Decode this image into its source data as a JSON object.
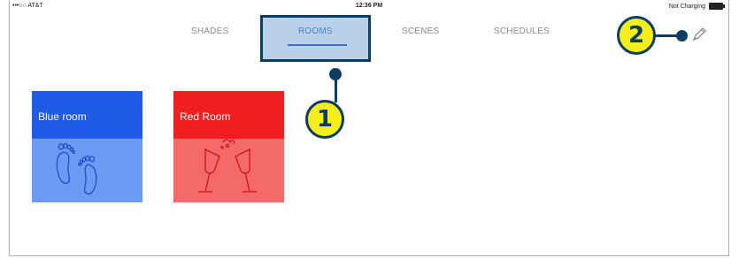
{
  "status_bar": {
    "carrier": "•••○○ AT&T",
    "time": "12:36 PM",
    "battery": "Not Charging"
  },
  "tabs": [
    {
      "label": "SHADES",
      "active": false
    },
    {
      "label": "ROOMS",
      "active": true
    },
    {
      "label": "SCENES",
      "active": false
    },
    {
      "label": "SCHEDULES",
      "active": false
    }
  ],
  "edit_icon": "pencil-icon",
  "rooms": [
    {
      "name": "Blue room",
      "top_color": "#1f5be6",
      "bottom_color": "#6a9af2",
      "icon": "feet-icon"
    },
    {
      "name": "Red Room",
      "top_color": "#ef1f1f",
      "bottom_color": "#f46a6a",
      "icon": "champagne-glasses-icon"
    }
  ],
  "callouts": [
    {
      "number": "1"
    },
    {
      "number": "2"
    }
  ],
  "colors": {
    "callout_fill": "#f4ee1c",
    "callout_border": "#0d3d63",
    "tab_active": "#4a7fd0",
    "highlight": "#6496cd"
  }
}
